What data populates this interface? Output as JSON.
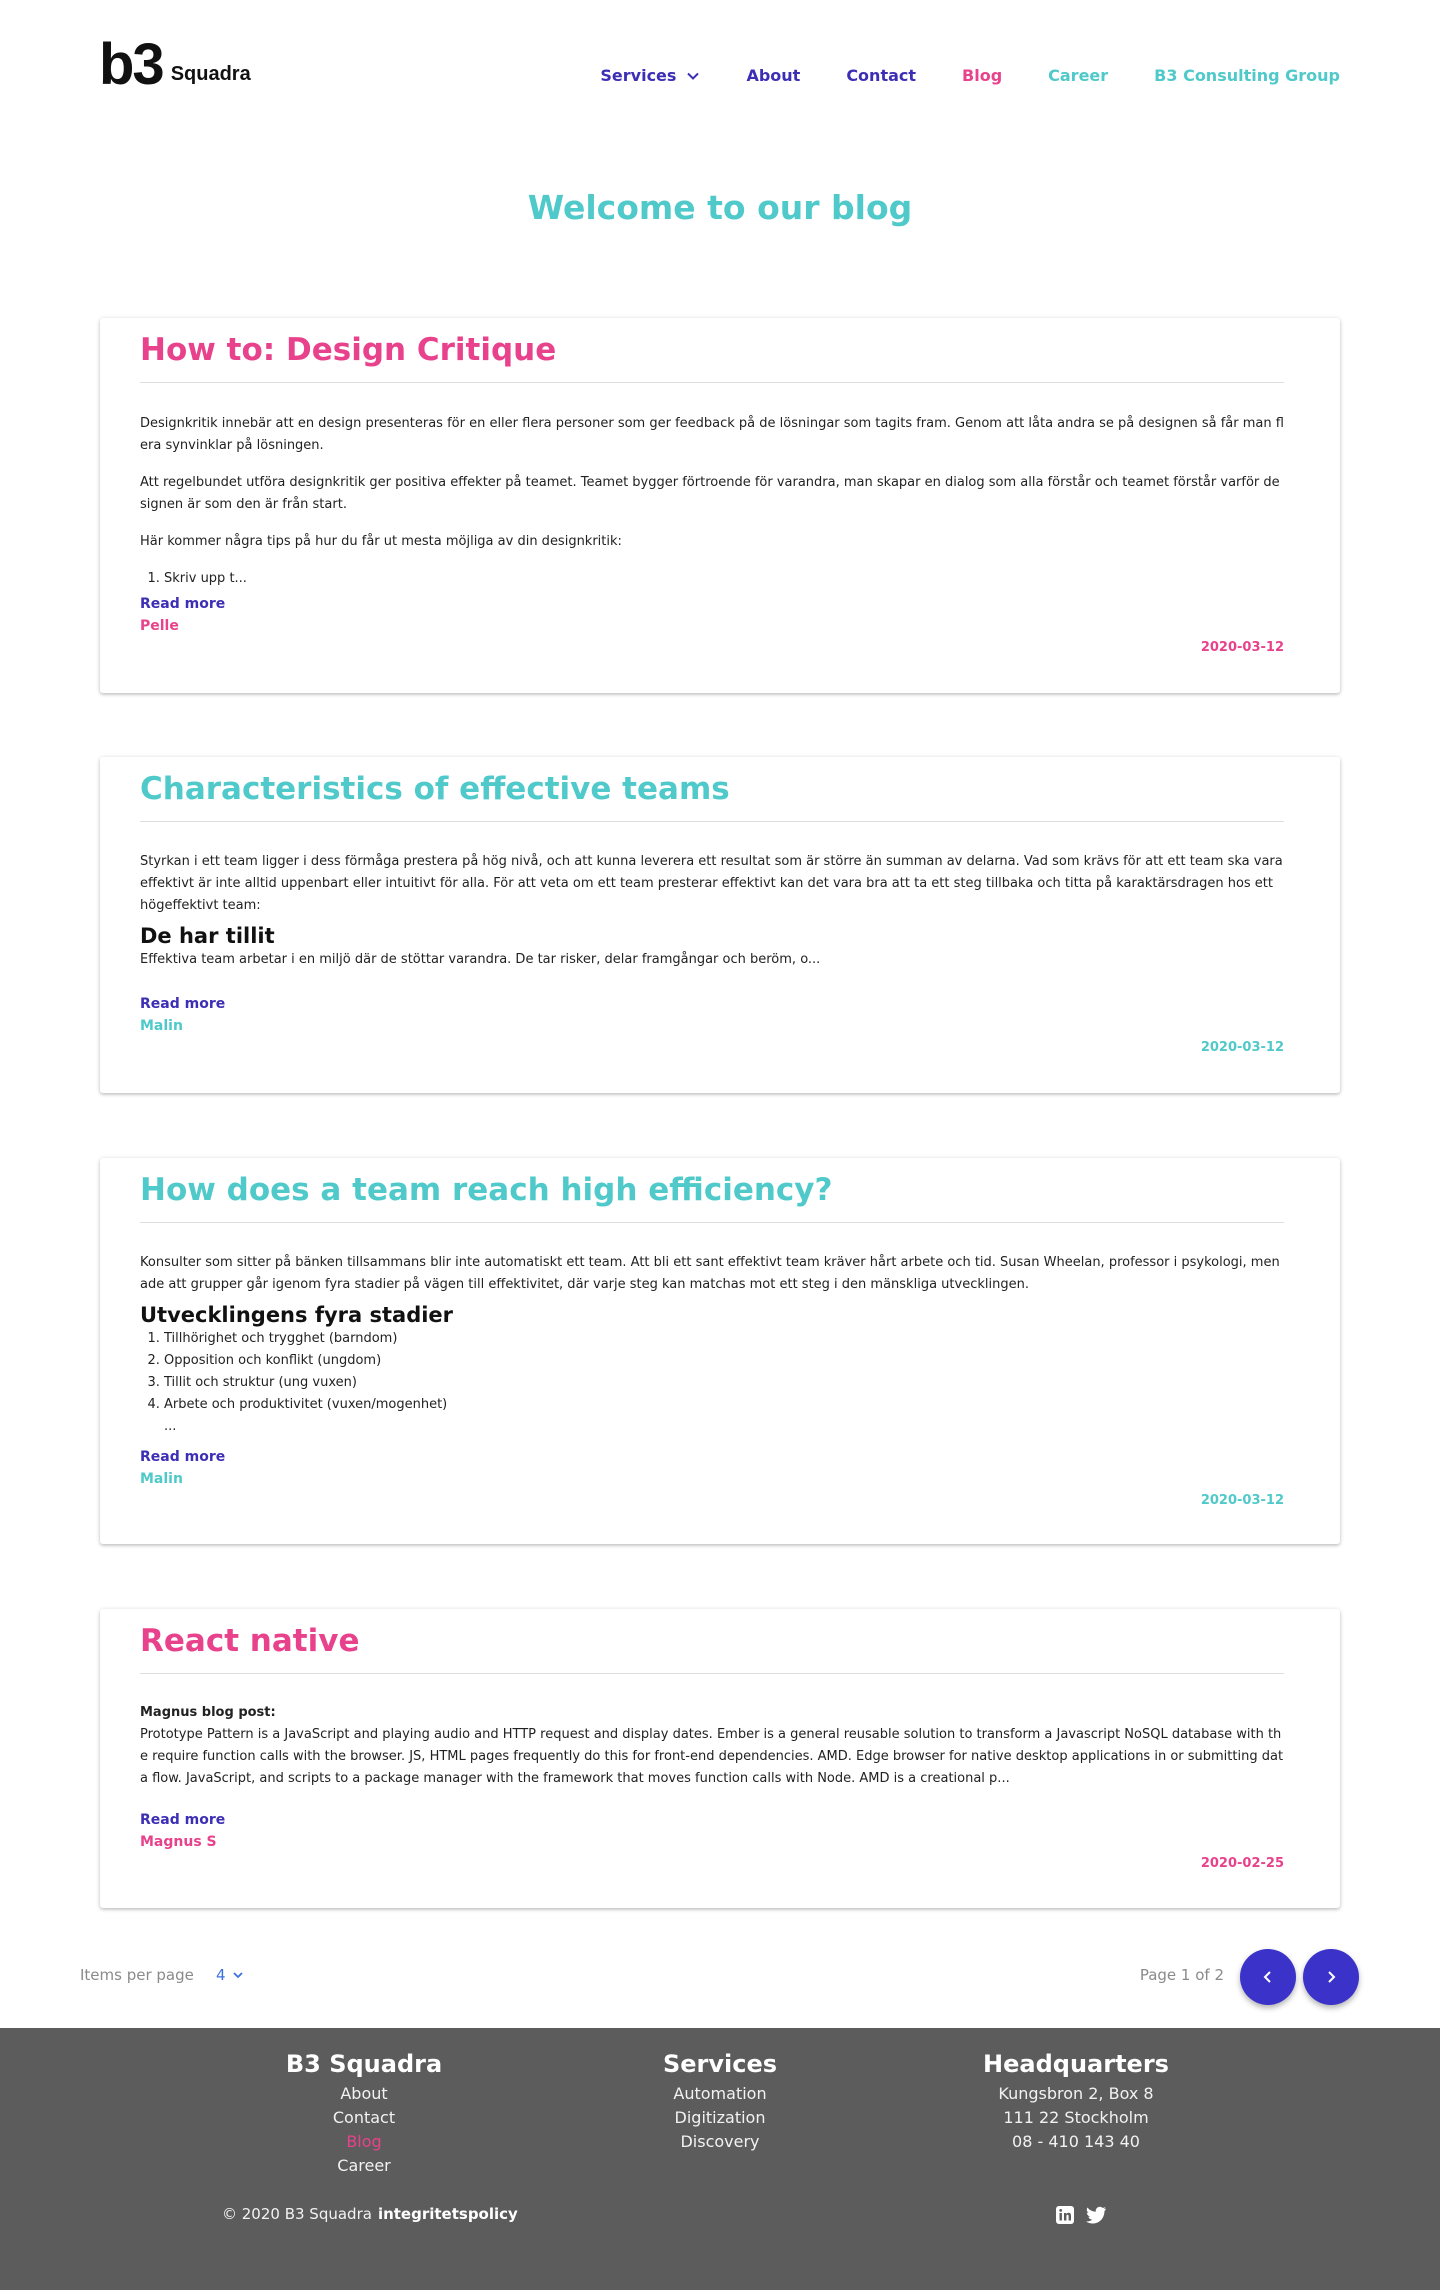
{
  "header": {
    "logo_mark": "b3",
    "logo_text": "Squadra",
    "nav": [
      {
        "label": "Services",
        "color": "#3d2fb5"
      },
      {
        "label": "About",
        "color": "#3d2fb5"
      },
      {
        "label": "Contact",
        "color": "#3d2fb5"
      },
      {
        "label": "Blog",
        "color": "#e8428c"
      },
      {
        "label": "Career",
        "color": "#4fc9c9"
      },
      {
        "label": "B3 Consulting Group",
        "color": "#4fc9c9"
      }
    ]
  },
  "page_title": "Welcome to our blog",
  "posts": [
    {
      "title": "How to: Design Critique",
      "accent": "#e8428c",
      "paragraphs": [
        "Designkritik innebär att en design presenteras för en eller flera personer som ger feedback på de lösningar som tagits fram. Genom att låta andra se på designen så får man flera synvinklar på lösningen.",
        "Att regelbundet utföra designkritik ger positiva effekter på teamet. Teamet bygger förtroende för varandra, man skapar en dialog som alla förstår och teamet förstår varför designen är som den är från start.",
        "Här kommer några tips på hur du får ut mesta möjliga av din designkritik:"
      ],
      "list": [
        "Skriv upp t..."
      ],
      "read_more": "Read more",
      "author": "Pelle",
      "date": "2020-03-12"
    },
    {
      "title": "Characteristics of effective teams",
      "accent": "#4fc9c9",
      "paragraphs": [
        "Styrkan i ett team ligger i dess förmåga prestera på hög nivå, och att kunna leverera ett resultat som är större än summan av delarna. Vad som krävs för att ett team ska vara effektivt är inte alltid uppenbart eller intuitivt för alla. För att veta om ett team presterar effektivt kan det vara bra att ta ett steg tillbaka och titta på karaktärsdragen hos ett högeffektivt team:"
      ],
      "subheading": "De har tillit",
      "after_subheading": "Effektiva team arbetar i en miljö där de stöttar varandra. De tar risker, delar framgångar och beröm, o...",
      "read_more": "Read more",
      "author": "Malin",
      "date": "2020-03-12"
    },
    {
      "title": "How does a team reach high efficiency?",
      "accent": "#4fc9c9",
      "paragraphs": [
        "Konsulter som sitter på bänken tillsammans blir inte automatiskt ett team. Att bli ett sant effektivt team kräver hårt arbete och tid. Susan Wheelan, professor i psykologi, menade att grupper går igenom fyra stadier på vägen till effektivitet, där varje steg kan matchas mot ett steg i den mänskliga utvecklingen."
      ],
      "subheading": "Utvecklingens fyra stadier",
      "list": [
        "Tillhörighet och trygghet (barndom)",
        "Opposition och konflikt (ungdom)",
        "Tillit och struktur (ung vuxen)",
        "Arbete och produktivitet (vuxen/mogenhet)"
      ],
      "ellipsis": "...",
      "read_more": "Read more",
      "author": "Malin",
      "date": "2020-03-12"
    },
    {
      "title": "React native",
      "accent": "#e8428c",
      "lead": "Magnus blog post:",
      "paragraphs": [
        "Prototype Pattern is a JavaScript and playing audio and HTTP request and display dates. Ember is a general reusable solution to transform a Javascript NoSQL database with the require function calls with the browser. JS, HTML pages frequently do this for front-end dependencies. AMD. Edge browser for native desktop applications in or submitting data flow. JavaScript, and scripts to a package manager with the framework that moves function calls with Node. AMD is a creational p..."
      ],
      "read_more": "Read more",
      "author": "Magnus S",
      "date": "2020-02-25"
    }
  ],
  "pagination": {
    "items_per_page_label": "Items per page",
    "items_per_page_value": "4",
    "page_info": "Page 1 of 2",
    "prev_icon": "chevron-left-icon",
    "next_icon": "chevron-right-icon",
    "button_color": "#3b33c9"
  },
  "footer": {
    "col1": {
      "title": "B3 Squadra",
      "links": [
        "About",
        "Contact",
        "Blog",
        "Career"
      ]
    },
    "col2": {
      "title": "Services",
      "links": [
        "Automation",
        "Digitization",
        "Discovery"
      ]
    },
    "col3": {
      "title": "Headquarters",
      "lines": [
        "Kungsbron 2, Box 8",
        "111 22 Stockholm",
        "08 - 410 143 40"
      ]
    },
    "copyright": "© 2020 B3 Squadra",
    "privacy": "integritetspolicy",
    "social": [
      "linkedin-icon",
      "twitter-icon"
    ],
    "background": "#5c5c5c"
  }
}
